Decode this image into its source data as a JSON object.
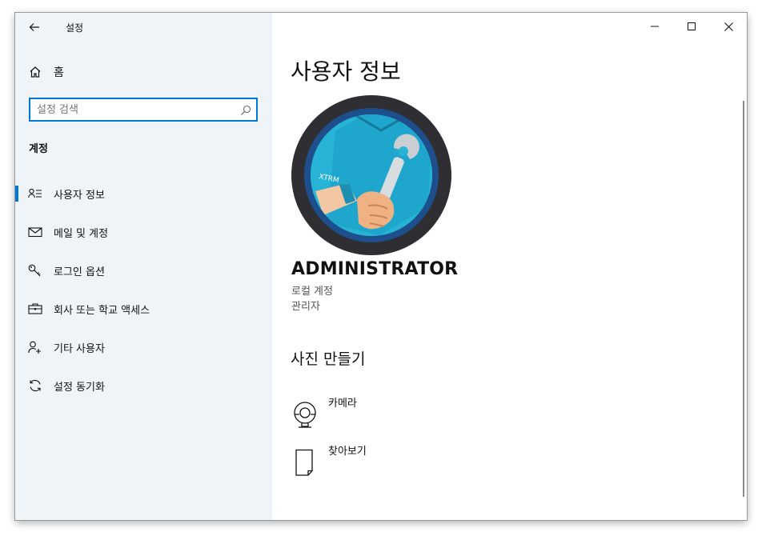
{
  "window": {
    "title": "설정"
  },
  "titlebar": {
    "back_icon": "back-arrow-icon",
    "controls": [
      "minimize-icon",
      "maximize-icon",
      "close-icon"
    ]
  },
  "sidebar": {
    "home_label": "홈",
    "search_placeholder": "설정 검색",
    "section": "계정",
    "items": [
      {
        "label": "사용자 정보",
        "icon": "user-info-icon",
        "selected": true
      },
      {
        "label": "메일 및 계정",
        "icon": "mail-icon",
        "selected": false
      },
      {
        "label": "로그인 옵션",
        "icon": "key-icon",
        "selected": false
      },
      {
        "label": "회사 또는 학교 액세스",
        "icon": "briefcase-icon",
        "selected": false
      },
      {
        "label": "기타 사용자",
        "icon": "add-user-icon",
        "selected": false
      },
      {
        "label": "설정 동기화",
        "icon": "sync-icon",
        "selected": false
      }
    ]
  },
  "main": {
    "page_title": "사용자 정보",
    "avatar_text": "XTRM",
    "user_name": "ADMINISTRATOR",
    "account_type": "로컬 계정",
    "role": "관리자",
    "photo_heading": "사진 만들기",
    "photo_options": [
      {
        "label": "카메라",
        "icon": "camera-icon"
      },
      {
        "label": "찾아보기",
        "icon": "browse-file-icon"
      }
    ]
  },
  "colors": {
    "accent": "#0078d7",
    "sidebar_bg": "#eff4f9"
  }
}
